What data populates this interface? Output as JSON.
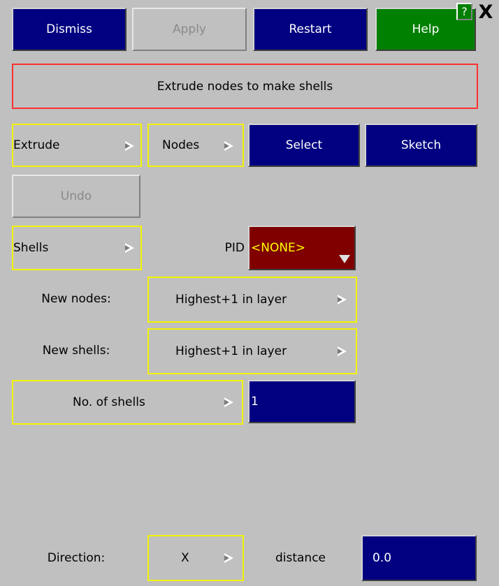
{
  "toolbar": {
    "dismiss": "Dismiss",
    "apply": "Apply",
    "restart": "Restart",
    "help": "Help",
    "question": "?",
    "close": "X"
  },
  "title": "Extrude nodes to make shells",
  "row_extrude": {
    "mode": "Extrude",
    "entity": "Nodes",
    "select": "Select",
    "sketch": "Sketch"
  },
  "undo": "Undo",
  "row_shells": {
    "type": "Shells",
    "pid_label": "PID",
    "pid_value": "<NONE>"
  },
  "new_nodes": {
    "label": "New nodes:",
    "value": "Highest+1 in layer"
  },
  "new_shells": {
    "label": "New shells:",
    "value": "Highest+1 in layer"
  },
  "no_of_shells": {
    "label": "No. of shells",
    "value": "1"
  },
  "direction": {
    "label": "Direction:",
    "value": "X",
    "distance_label": "distance",
    "distance_value": "0.0"
  },
  "colors": {
    "navy": "#000080",
    "green": "#008000",
    "pid_bg": "#800000",
    "pid_text": "#ffff00",
    "highlight_border": "#f3f300",
    "title_border": "#ff3030"
  }
}
